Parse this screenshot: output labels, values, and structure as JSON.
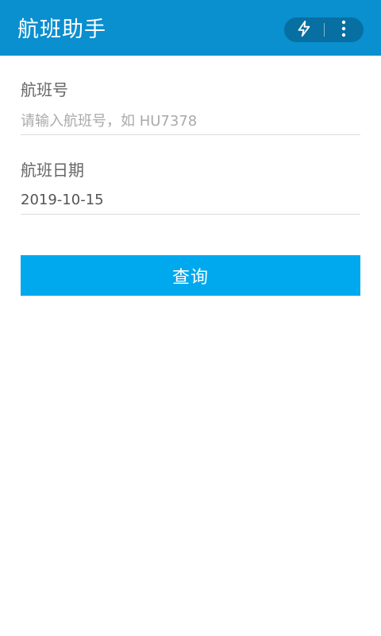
{
  "header": {
    "title": "航班助手",
    "icons": {
      "left": "lightning-icon",
      "right": "more-vertical-icon"
    },
    "colors": {
      "background": "#0a8fcf",
      "text": "#ffffff"
    }
  },
  "form": {
    "flight_number": {
      "label": "航班号",
      "value": "",
      "placeholder": "请输入航班号，如 HU7378"
    },
    "flight_date": {
      "label": "航班日期",
      "value": "2019-10-15"
    },
    "submit": {
      "label": "查询",
      "color": "#00a9ee"
    }
  }
}
